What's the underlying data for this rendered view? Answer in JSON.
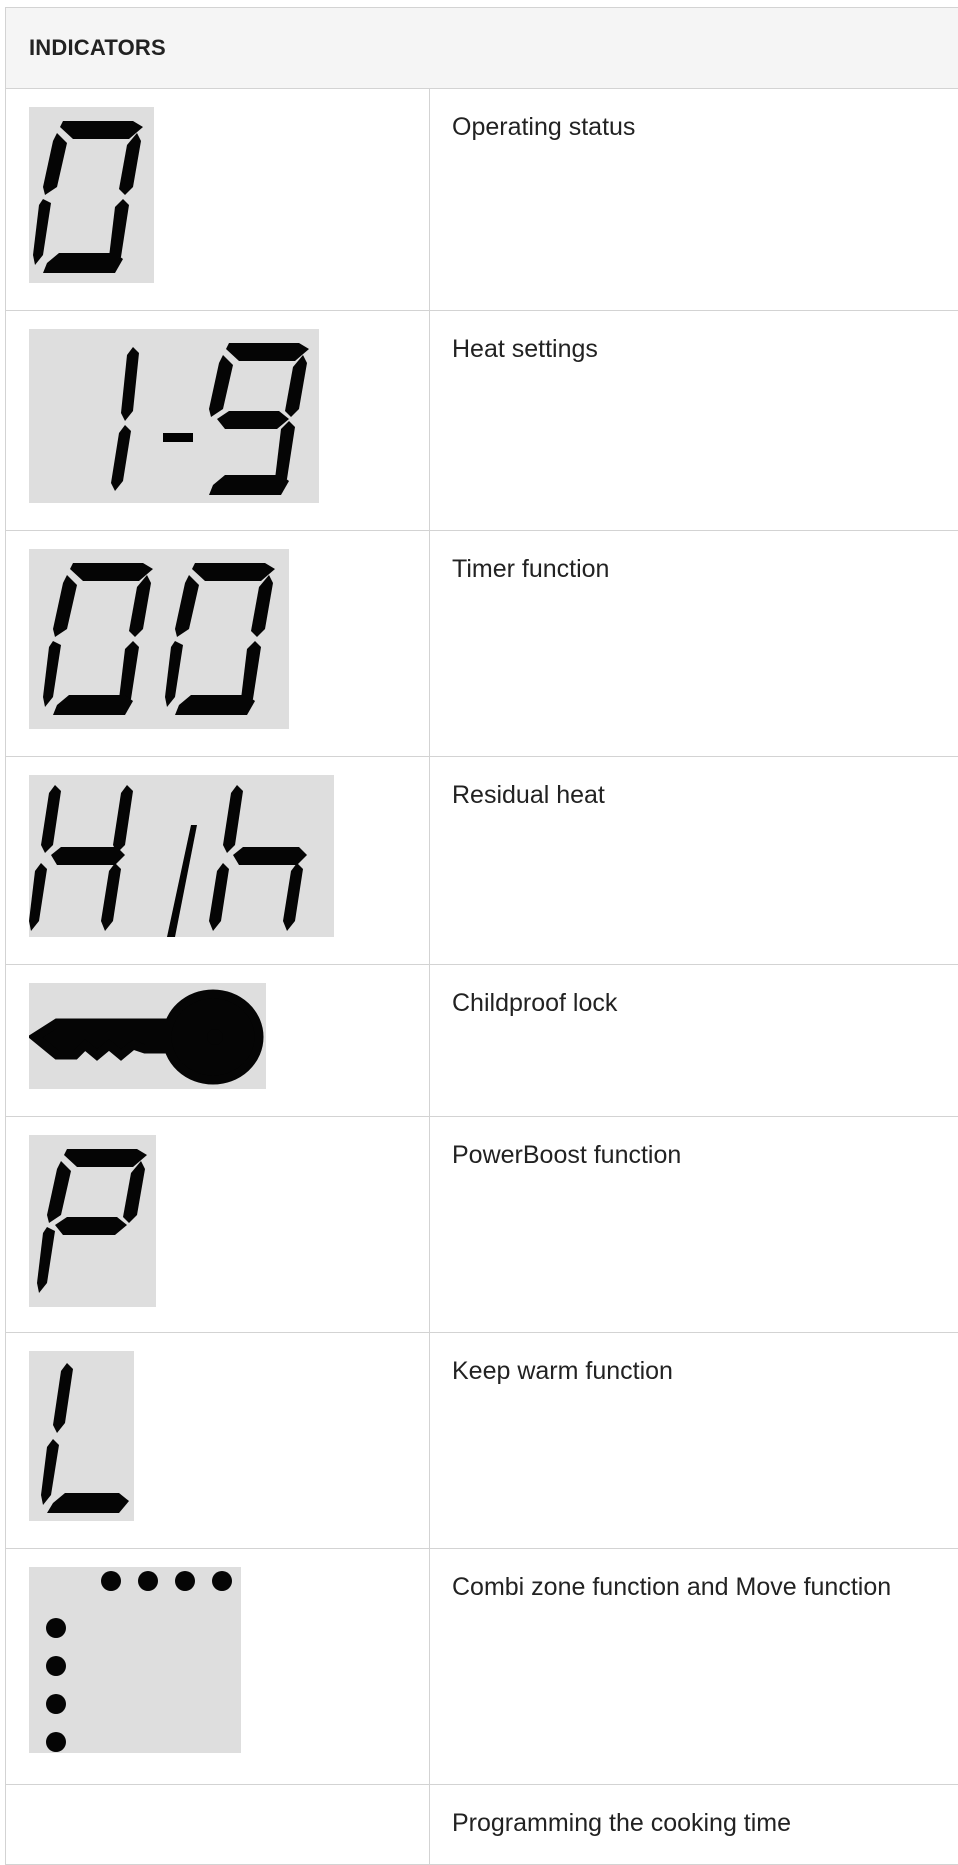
{
  "table": {
    "header": "INDICATORS",
    "rows": [
      {
        "icon": "digit-zero-display-icon",
        "label": "Operating status"
      },
      {
        "icon": "digits-one-to-nine-display-icon",
        "label": "Heat settings"
      },
      {
        "icon": "double-zero-display-icon",
        "label": "Timer function"
      },
      {
        "icon": "h-slash-h-display-icon",
        "label": "Residual heat"
      },
      {
        "icon": "key-icon",
        "label": "Childproof lock"
      },
      {
        "icon": "letter-p-display-icon",
        "label": "PowerBoost function"
      },
      {
        "icon": "letter-l-display-icon",
        "label": "Keep warm function"
      },
      {
        "icon": "dots-corner-display-icon",
        "label": "Combi zone function and Move function"
      },
      {
        "icon": "",
        "label": "Programming the cooking time"
      }
    ]
  }
}
